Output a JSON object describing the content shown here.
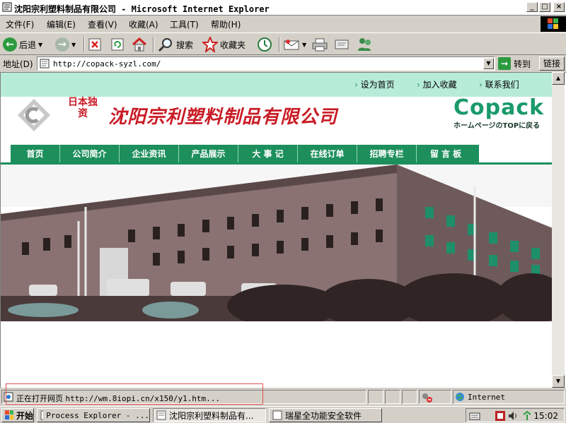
{
  "window": {
    "title": "沈阳宗利塑料制品有限公司 - Microsoft Internet Explorer",
    "min_glyph": "_",
    "max_glyph": "□",
    "close_glyph": "×"
  },
  "menu": [
    "文件(F)",
    "编辑(E)",
    "查看(V)",
    "收藏(A)",
    "工具(T)",
    "帮助(H)"
  ],
  "toolbar": {
    "back_label": "后退",
    "search_label": "搜索",
    "favorites_label": "收藏夹"
  },
  "address": {
    "label": "地址(D)",
    "url": "http://copack-syzl.com/",
    "go_label": "转到",
    "links_label": "链接"
  },
  "page": {
    "top_links": [
      "设为首页",
      "加入收藏",
      "联系我们"
    ],
    "jp_label": "日本独资",
    "company_name": "沈阳宗利塑料制品有限公司",
    "brand_name": "Copack",
    "brand_sub": "ホームページのTOPに戻る",
    "nav": [
      "首页",
      "公司简介",
      "企业资讯",
      "产品展示",
      "大 事 记",
      "在线订单",
      "招聘专栏",
      "留 言 板"
    ]
  },
  "status": {
    "text": "正在打开网页",
    "url": "http://wm.8iopi.cn/x150/y1.htm...",
    "zone": "Internet"
  },
  "taskbar": {
    "start_label": "开始",
    "tasks": [
      "Process Explorer - ...",
      "沈阳宗利塑料制品有...",
      "瑞星全功能安全软件"
    ],
    "clock": "15:02"
  },
  "colors": {
    "accent_green": "#1d8f5c",
    "header_band": "#b7ecd9",
    "company_red": "#c91b25"
  }
}
